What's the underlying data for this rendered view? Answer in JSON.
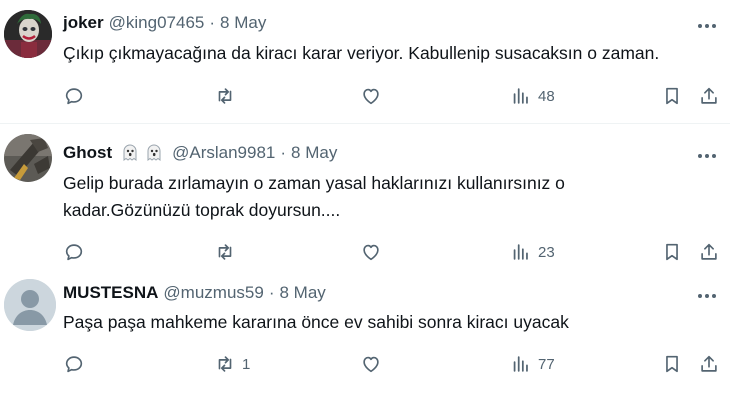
{
  "tweets": [
    {
      "name": "joker",
      "handle": "@king07465",
      "separator": "·",
      "date": "8 May",
      "text_lines": [
        "Çıkıp çıkmayacağına da kiracı karar veriyor. Kabullenip susacaksın o zaman."
      ],
      "reply_count": "",
      "retweet_count": "",
      "like_count": "",
      "views": "48"
    },
    {
      "name": "Ghost",
      "handle": "@Arslan9981",
      "separator": "·",
      "date": "8 May",
      "name_emojis": [
        "ghost-emoji",
        "ghost-emoji"
      ],
      "text_lines": [
        "Gelip burada zırlamayın o zaman yasal haklarınızı kullanırsınız o",
        "kadar.Gözünüzü toprak doyursun...."
      ],
      "reply_count": "",
      "retweet_count": "",
      "like_count": "",
      "views": "23"
    },
    {
      "name": "MUSTESNA",
      "handle": "@muzmus59",
      "separator": "·",
      "date": "8 May",
      "text_lines": [
        "Paşa paşa mahkeme kararına önce ev sahibi sonra kiracı uyacak"
      ],
      "reply_count": "",
      "retweet_count": "1",
      "like_count": "",
      "views": "77"
    }
  ],
  "icons": {
    "reply": "reply-icon",
    "retweet": "retweet-icon",
    "like": "heart-icon",
    "views": "views-icon",
    "bookmark": "bookmark-icon",
    "share": "share-icon",
    "more": "more-icon"
  },
  "colors": {
    "text": "#0f1419",
    "secondary": "#536471",
    "divider": "#eff3f4"
  }
}
